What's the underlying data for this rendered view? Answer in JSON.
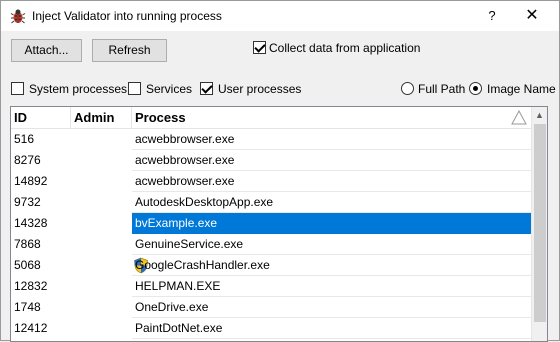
{
  "window": {
    "title": "Inject Validator into running process",
    "help_label": "?",
    "close_label": "✕"
  },
  "toolbar": {
    "attach_label": "Attach...",
    "refresh_label": "Refresh",
    "collect_label": "Collect data from application",
    "collect_checked": true
  },
  "filters": {
    "system_label": "System processes",
    "system_checked": false,
    "services_label": "Services",
    "services_checked": false,
    "user_label": "User processes",
    "user_checked": true,
    "fullpath_label": "Full Path",
    "fullpath_selected": false,
    "imagename_label": "Image Name",
    "imagename_selected": true
  },
  "table": {
    "columns": [
      "ID",
      "Admin",
      "Process"
    ],
    "rows": [
      {
        "id": "516",
        "admin": false,
        "process": "acwebbrowser.exe"
      },
      {
        "id": "8276",
        "admin": false,
        "process": "acwebbrowser.exe"
      },
      {
        "id": "14892",
        "admin": false,
        "process": "acwebbrowser.exe"
      },
      {
        "id": "9732",
        "admin": false,
        "process": "AutodeskDesktopApp.exe"
      },
      {
        "id": "14328",
        "admin": false,
        "process": "bvExample.exe",
        "selected": true
      },
      {
        "id": "7868",
        "admin": false,
        "process": "GenuineService.exe"
      },
      {
        "id": "5068",
        "admin": true,
        "process": "GoogleCrashHandler.exe"
      },
      {
        "id": "12832",
        "admin": false,
        "process": "HELPMAN.EXE"
      },
      {
        "id": "1748",
        "admin": false,
        "process": "OneDrive.exe"
      },
      {
        "id": "12412",
        "admin": false,
        "process": "PaintDotNet.exe"
      }
    ],
    "selected_color": "#0078d7"
  },
  "icons": {
    "app": "bug-icon",
    "admin": "uac-shield-icon",
    "sort": "sort-ascending-icon"
  }
}
